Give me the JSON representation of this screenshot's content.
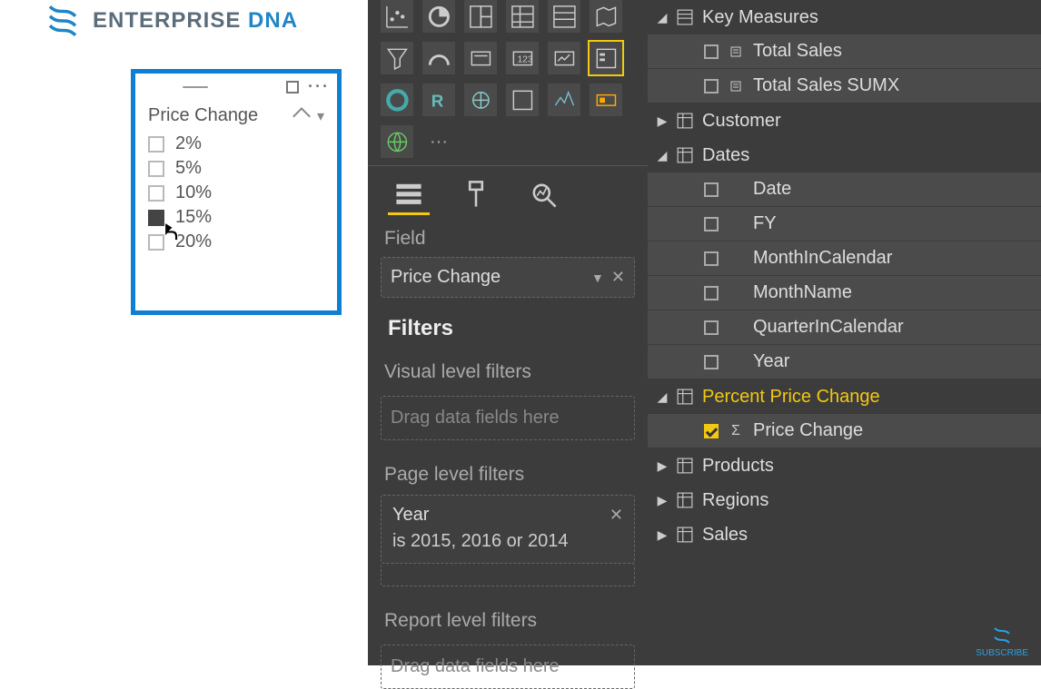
{
  "logo": {
    "brand": "ENTERPRISE",
    "accent": "DNA"
  },
  "slicer": {
    "title": "Price Change",
    "items": [
      {
        "label": "2%",
        "checked": false
      },
      {
        "label": "5%",
        "checked": false
      },
      {
        "label": "10%",
        "checked": false
      },
      {
        "label": "15%",
        "checked": true
      },
      {
        "label": "20%",
        "checked": false
      }
    ]
  },
  "viz": {
    "field_section": "Field",
    "field_value": "Price Change",
    "filters_header": "Filters",
    "visual_level": "Visual level filters",
    "drag_here": "Drag data fields here",
    "page_level": "Page level filters",
    "page_filter_name": "Year",
    "page_filter_desc": "is 2015, 2016 or 2014",
    "report_level": "Report level filters"
  },
  "fields": {
    "key_measures": {
      "label": "Key Measures",
      "expanded": true
    },
    "key_measures_children": [
      {
        "label": "Total Sales",
        "type": "measure"
      },
      {
        "label": "Total Sales SUMX",
        "type": "measure"
      }
    ],
    "customer": {
      "label": "Customer",
      "expanded": false
    },
    "dates": {
      "label": "Dates",
      "expanded": true
    },
    "dates_children": [
      {
        "label": "Date"
      },
      {
        "label": "FY"
      },
      {
        "label": "MonthInCalendar"
      },
      {
        "label": "MonthName"
      },
      {
        "label": "QuarterInCalendar"
      },
      {
        "label": "Year"
      }
    ],
    "ppc": {
      "label": "Percent Price Change",
      "expanded": true,
      "selected": true
    },
    "ppc_children": [
      {
        "label": "Price Change",
        "checked": true,
        "sigma": true
      }
    ],
    "products": {
      "label": "Products",
      "expanded": false
    },
    "regions": {
      "label": "Regions",
      "expanded": false
    },
    "sales": {
      "label": "Sales",
      "expanded": false
    }
  },
  "subscribe": "SUBSCRIBE"
}
